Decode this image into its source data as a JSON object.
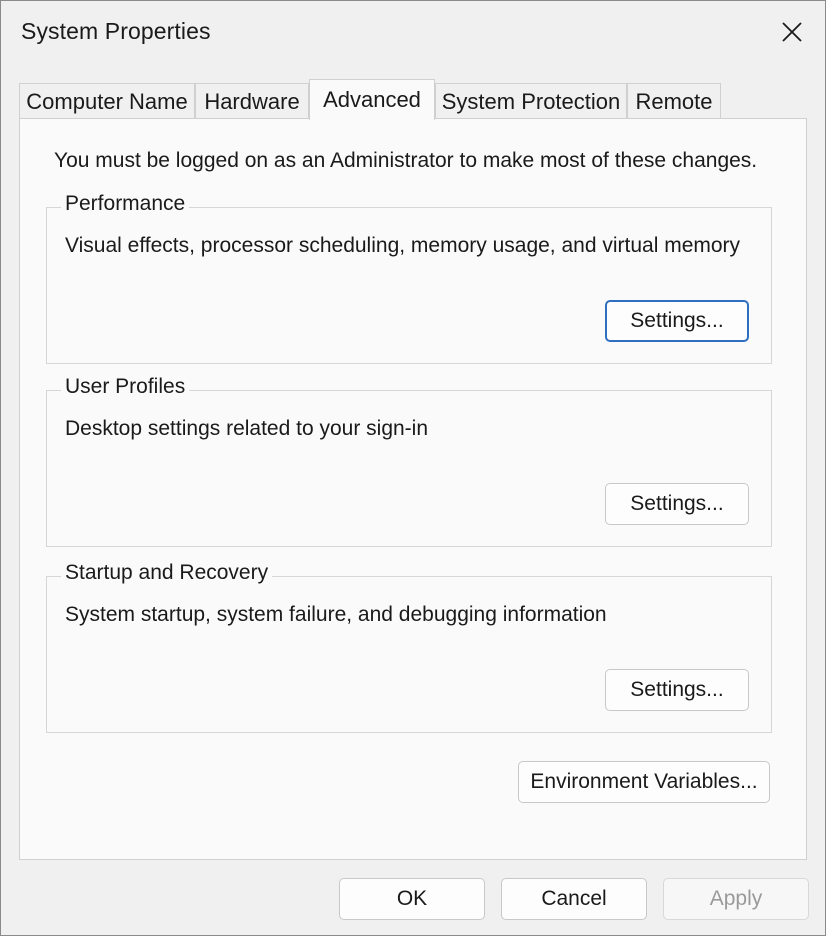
{
  "window": {
    "title": "System Properties"
  },
  "tabs": [
    {
      "label": "Computer Name",
      "active": false
    },
    {
      "label": "Hardware",
      "active": false
    },
    {
      "label": "Advanced",
      "active": true
    },
    {
      "label": "System Protection",
      "active": false
    },
    {
      "label": "Remote",
      "active": false
    }
  ],
  "panel": {
    "admin_note": "You must be logged on as an Administrator to make most of these changes.",
    "performance": {
      "legend": "Performance",
      "description": "Visual effects, processor scheduling, memory usage, and virtual memory",
      "settings_label": "Settings..."
    },
    "user_profiles": {
      "legend": "User Profiles",
      "description": "Desktop settings related to your sign-in",
      "settings_label": "Settings..."
    },
    "startup_recovery": {
      "legend": "Startup and Recovery",
      "description": "System startup, system failure, and debugging information",
      "settings_label": "Settings..."
    },
    "env_vars_label": "Environment Variables..."
  },
  "footer": {
    "ok_label": "OK",
    "cancel_label": "Cancel",
    "apply_label": "Apply",
    "apply_enabled": false
  },
  "icons": {
    "close": "close-icon"
  },
  "colors": {
    "focus_border": "#2f6fc2",
    "window_bg": "#f0f0f0",
    "panel_bg": "#fafafa"
  }
}
